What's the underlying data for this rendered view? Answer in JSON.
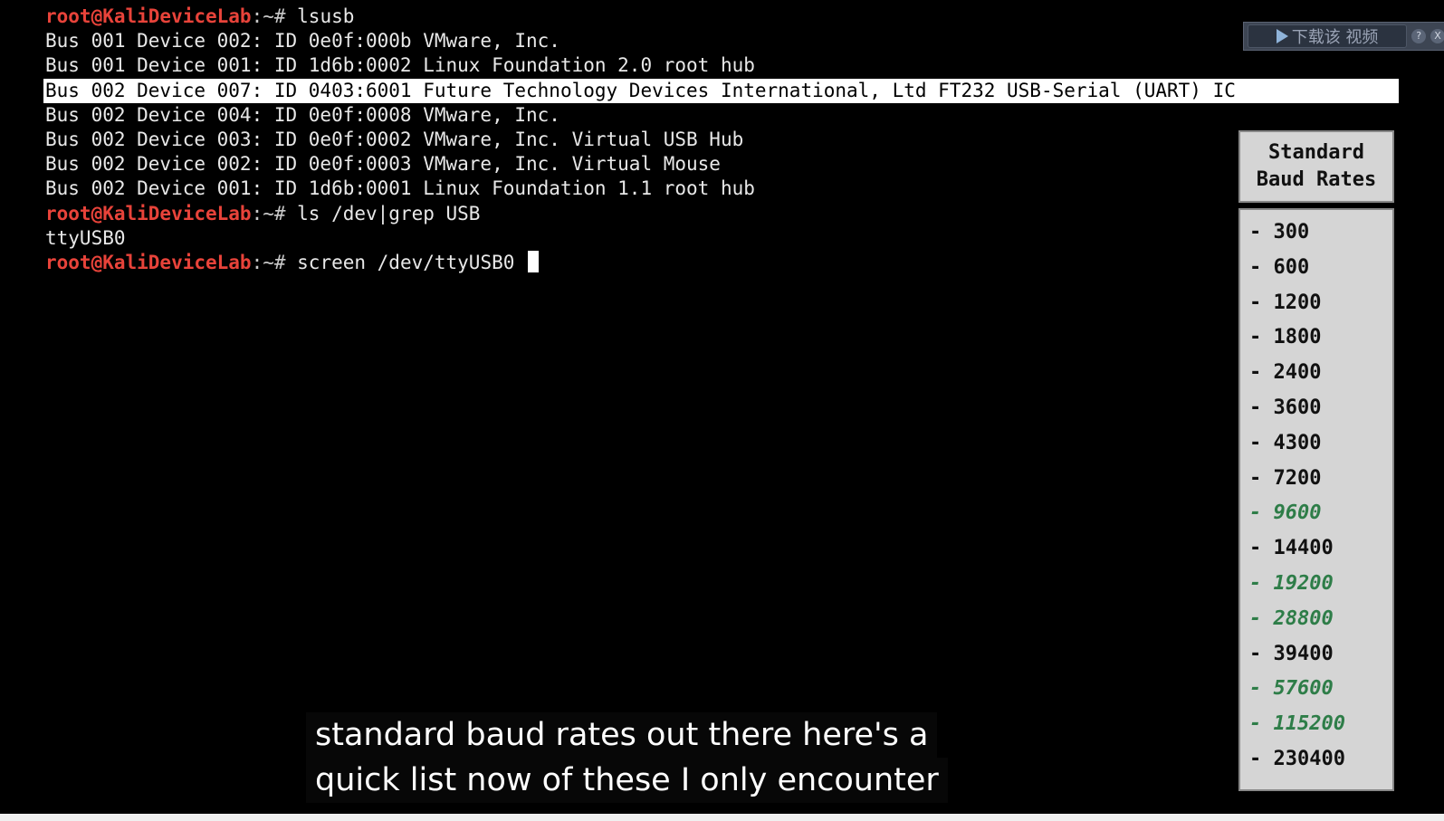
{
  "terminal": {
    "prompt_user": "root@KaliDeviceLab",
    "prompt_path": ":~# ",
    "lines": [
      {
        "type": "cmd",
        "text": "lsusb"
      },
      {
        "type": "out",
        "text": "Bus 001 Device 002: ID 0e0f:000b VMware, Inc."
      },
      {
        "type": "out",
        "text": "Bus 001 Device 001: ID 1d6b:0002 Linux Foundation 2.0 root hub"
      },
      {
        "type": "hl",
        "text": "Bus 002 Device 007: ID 0403:6001 Future Technology Devices International, Ltd FT232 USB-Serial (UART) IC"
      },
      {
        "type": "out",
        "text": "Bus 002 Device 004: ID 0e0f:0008 VMware, Inc."
      },
      {
        "type": "out",
        "text": "Bus 002 Device 003: ID 0e0f:0002 VMware, Inc. Virtual USB Hub"
      },
      {
        "type": "out",
        "text": "Bus 002 Device 002: ID 0e0f:0003 VMware, Inc. Virtual Mouse"
      },
      {
        "type": "out",
        "text": "Bus 002 Device 001: ID 1d6b:0001 Linux Foundation 1.1 root hub"
      },
      {
        "type": "cmd",
        "text": "ls /dev|grep USB"
      },
      {
        "type": "out",
        "text": "ttyUSB0"
      },
      {
        "type": "cmd",
        "text": "screen /dev/ttyUSB0 ",
        "cursor": true
      }
    ]
  },
  "download_bar": {
    "label": "下载该 视频",
    "help": "?",
    "close": "X"
  },
  "baud_panel": {
    "title_line1": "Standard",
    "title_line2": "Baud Rates",
    "rates": [
      {
        "text": "- 300",
        "highlight": false
      },
      {
        "text": "- 600",
        "highlight": false
      },
      {
        "text": "- 1200",
        "highlight": false
      },
      {
        "text": "- 1800",
        "highlight": false
      },
      {
        "text": "- 2400",
        "highlight": false
      },
      {
        "text": "- 3600",
        "highlight": false
      },
      {
        "text": "- 4300",
        "highlight": false
      },
      {
        "text": "- 7200",
        "highlight": false
      },
      {
        "text": "- 9600",
        "highlight": true
      },
      {
        "text": "- 14400",
        "highlight": false
      },
      {
        "text": "- 19200",
        "highlight": true
      },
      {
        "text": "- 28800",
        "highlight": true
      },
      {
        "text": "- 39400",
        "highlight": false
      },
      {
        "text": "- 57600",
        "highlight": true
      },
      {
        "text": "- 115200",
        "highlight": true
      },
      {
        "text": "- 230400",
        "highlight": false
      }
    ],
    "highlight_color": "#2e7d48"
  },
  "caption": {
    "line1": "standard baud rates out there here's a",
    "line2": "quick list now of these I only encounter"
  }
}
